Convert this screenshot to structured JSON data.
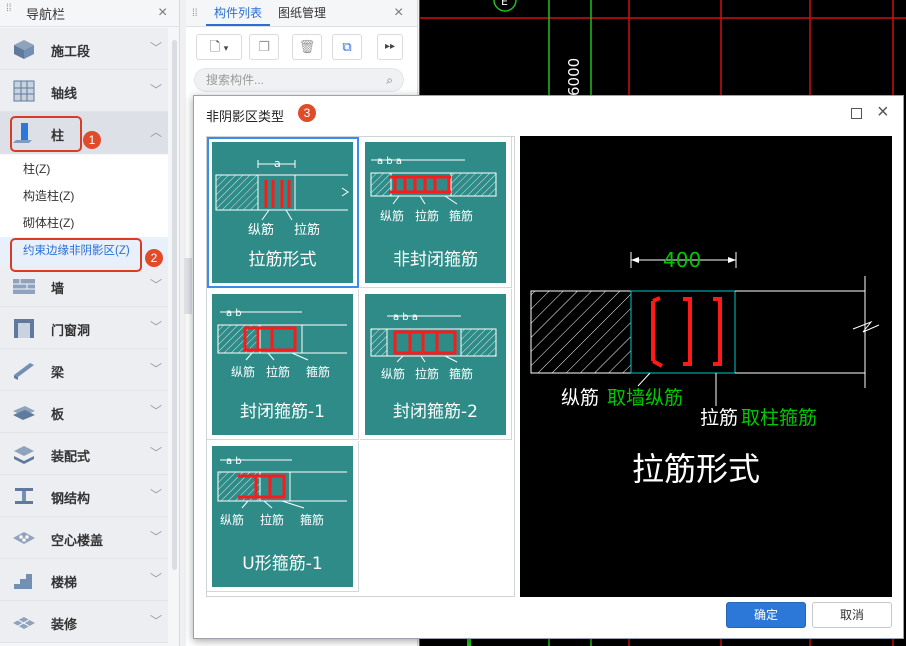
{
  "nav": {
    "title": "导航栏",
    "items": [
      {
        "label": "施工段",
        "icon": "cube-icon"
      },
      {
        "label": "轴线",
        "icon": "grid-icon"
      },
      {
        "label": "柱",
        "icon": "column-icon"
      },
      {
        "label": "墙",
        "icon": "wall-icon"
      },
      {
        "label": "门窗洞",
        "icon": "door-window-icon"
      },
      {
        "label": "梁",
        "icon": "beam-icon"
      },
      {
        "label": "板",
        "icon": "slab-icon"
      },
      {
        "label": "装配式",
        "icon": "prefab-icon"
      },
      {
        "label": "钢结构",
        "icon": "steel-icon"
      },
      {
        "label": "空心楼盖",
        "icon": "hollow-floor-icon"
      },
      {
        "label": "楼梯",
        "icon": "stairs-icon"
      },
      {
        "label": "装修",
        "icon": "decoration-icon"
      }
    ],
    "sub_items": [
      "柱(Z)",
      "构造柱(Z)",
      "砌体柱(Z)",
      "约束边缘非阴影区(Z)"
    ]
  },
  "badges": [
    "1",
    "2",
    "3"
  ],
  "panel": {
    "tab_active": "构件列表",
    "tab_other": "图纸管理",
    "search_placeholder": "搜索构件..."
  },
  "cad": {
    "label_e": "E",
    "dim": "6000"
  },
  "dialog": {
    "title": "非阴影区类型",
    "cards": [
      {
        "caption": "拉筋形式",
        "labels": [
          "纵筋",
          "拉筋"
        ],
        "dim": "a"
      },
      {
        "caption": "非封闭箍筋",
        "labels": [
          "纵筋",
          "拉筋",
          "箍筋"
        ],
        "dim": "a b a"
      },
      {
        "caption": "封闭箍筋-1",
        "labels": [
          "纵筋",
          "拉筋",
          "箍筋"
        ],
        "dim": "a b"
      },
      {
        "caption": "封闭箍筋-2",
        "labels": [
          "纵筋",
          "拉筋",
          "箍筋"
        ],
        "dim": "a b a"
      },
      {
        "caption": "U形箍筋-1",
        "labels": [
          "纵筋",
          "拉筋",
          "箍筋"
        ],
        "dim": "a b"
      }
    ],
    "preview": {
      "dim": "400",
      "label1_white": "纵筋",
      "label1_green": "取墙纵筋",
      "label2_white": "拉筋",
      "label2_green": "取柱箍筋",
      "caption": "拉筋形式"
    },
    "ok": "确定",
    "cancel": "取消"
  },
  "colors": {
    "card": "#2e8b88",
    "accent": "#2b78d8",
    "badge": "#e04c2a",
    "rebar": "#ff1a1a",
    "cad_green": "#00c800"
  }
}
